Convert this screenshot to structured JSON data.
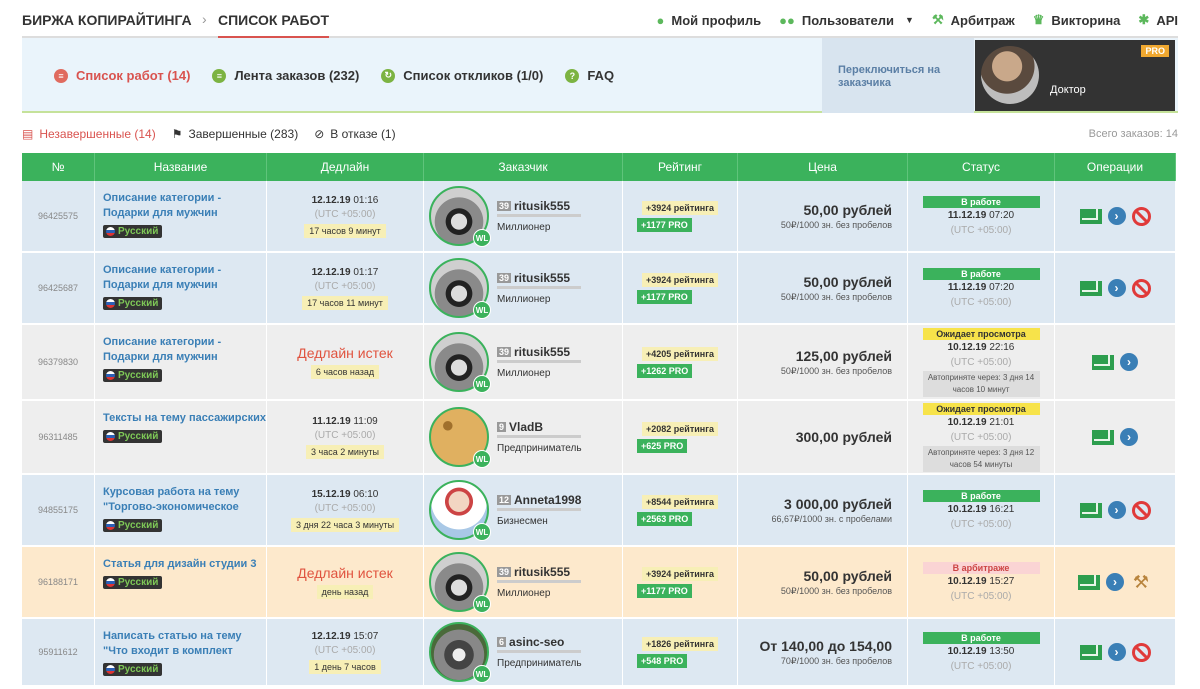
{
  "nav": {
    "brand": "БИРЖА КОПИРАЙТИНГА",
    "sep": "›",
    "current": "СПИСОК РАБОТ",
    "items": [
      {
        "label": "Мой профиль",
        "icon": "user-icon"
      },
      {
        "label": "Пользователи",
        "icon": "users-icon"
      },
      {
        "label": "Арбитраж",
        "icon": "hammer-icon"
      },
      {
        "label": "Викторина",
        "icon": "trophy-icon"
      },
      {
        "label": "API",
        "icon": "gear-icon"
      }
    ]
  },
  "subnav": {
    "tabs": [
      {
        "label": "Список работ (14)",
        "active": true
      },
      {
        "label": "Лента заказов (232)",
        "active": false
      },
      {
        "label": "Список откликов (1/0)",
        "active": false
      },
      {
        "label": "FAQ",
        "active": false
      }
    ],
    "switch_label": "Переключиться на заказчика",
    "profile_name": "Доктор",
    "pro": "PRO"
  },
  "filters": {
    "items": [
      {
        "label": "Незавершенные (14)",
        "active": true
      },
      {
        "label": "Завершенные (283)",
        "active": false
      },
      {
        "label": "В отказе (1)",
        "active": false
      }
    ],
    "total": "Всего заказов: 14"
  },
  "table": {
    "headers": [
      "№",
      "Название",
      "Дедлайн",
      "Заказчик",
      "Рейтинг",
      "Цена",
      "Статус",
      "Операции"
    ],
    "rows": [
      {
        "id": "96425575",
        "title": "Описание категории - Подарки для мужчин",
        "lang": "Русский",
        "dl_date": "12.12.19",
        "dl_time": "01:16",
        "dl_utc": "(UTC +05:00)",
        "dl_left": "17 часов 9 минут",
        "dl_expired": "",
        "cust_level": "39",
        "cust_name": "ritusik555",
        "cust_rank": "Миллионер",
        "ava": "raccoon",
        "r1": "+3924 рейтинга",
        "r2": "+1177 PRO",
        "price": "50,00 рублей",
        "price_sub": "50₽/1000 зн. без пробелов",
        "status": "В работе",
        "status_kind": "green",
        "s_date": "11.12.19",
        "s_time": "07:20",
        "s_utc": "(UTC +05:00)",
        "s_auto": "",
        "ops": [
          "mail",
          "go",
          "ban"
        ]
      },
      {
        "id": "96425687",
        "title": "Описание категории - Подарки для мужчин",
        "lang": "Русский",
        "dl_date": "12.12.19",
        "dl_time": "01:17",
        "dl_utc": "(UTC +05:00)",
        "dl_left": "17 часов 11 минут",
        "dl_expired": "",
        "cust_level": "39",
        "cust_name": "ritusik555",
        "cust_rank": "Миллионер",
        "ava": "raccoon",
        "r1": "+3924 рейтинга",
        "r2": "+1177 PRO",
        "price": "50,00 рублей",
        "price_sub": "50₽/1000 зн. без пробелов",
        "status": "В работе",
        "status_kind": "green",
        "s_date": "11.12.19",
        "s_time": "07:20",
        "s_utc": "(UTC +05:00)",
        "s_auto": "",
        "ops": [
          "mail",
          "go",
          "ban"
        ]
      },
      {
        "id": "96379830",
        "title": "Описание категории - Подарки для мужчин",
        "lang": "Русский",
        "dl_date": "",
        "dl_time": "",
        "dl_utc": "",
        "dl_left": "6 часов назад",
        "dl_expired": "Дедлайн истек",
        "cust_level": "39",
        "cust_name": "ritusik555",
        "cust_rank": "Миллионер",
        "ava": "raccoon",
        "r1": "+4205 рейтинга",
        "r2": "+1262 PRO",
        "price": "125,00 рублей",
        "price_sub": "50₽/1000 зн. без пробелов",
        "status": "Ожидает просмотра",
        "status_kind": "yellow",
        "s_date": "10.12.19",
        "s_time": "22:16",
        "s_utc": "(UTC +05:00)",
        "s_auto": "Автоприняте через: 3 дня 14 часов 10 минут",
        "ops": [
          "mail",
          "go"
        ]
      },
      {
        "id": "96311485",
        "title": "Тексты на тему пассажирских",
        "lang": "Русский",
        "dl_date": "11.12.19",
        "dl_time": "11:09",
        "dl_utc": "(UTC +05:00)",
        "dl_left": "3 часа 2 минуты",
        "dl_expired": "",
        "cust_level": "9",
        "cust_name": "VladB",
        "cust_rank": "Предприниматель",
        "ava": "leopard",
        "r1": "+2082 рейтинга",
        "r2": "+625 PRO",
        "price": "300,00 рублей",
        "price_sub": "",
        "status": "Ожидает просмотра",
        "status_kind": "yellow",
        "s_date": "10.12.19",
        "s_time": "21:01",
        "s_utc": "(UTC +05:00)",
        "s_auto": "Автоприняте через: 3 дня 12 часов 54 минуты",
        "ops": [
          "mail",
          "go"
        ]
      },
      {
        "id": "94855175",
        "title": "Курсовая работа на тему \"Торгово-экономическое",
        "lang": "Русский",
        "dl_date": "15.12.19",
        "dl_time": "06:10",
        "dl_utc": "(UTC +05:00)",
        "dl_left": "3 дня 22 часа 3 минуты",
        "dl_expired": "",
        "cust_level": "12",
        "cust_name": "Anneta1998",
        "cust_rank": "Бизнесмен",
        "ava": "girl",
        "r1": "+8544 рейтинга",
        "r2": "+2563 PRO",
        "price": "3 000,00 рублей",
        "price_sub": "66,67₽/1000 зн. с пробелами",
        "status": "В работе",
        "status_kind": "green",
        "s_date": "10.12.19",
        "s_time": "16:21",
        "s_utc": "(UTC +05:00)",
        "s_auto": "",
        "ops": [
          "mail",
          "go",
          "ban"
        ]
      },
      {
        "id": "96188171",
        "title": "Статья для дизайн студии 3",
        "lang": "Русский",
        "dl_date": "",
        "dl_time": "",
        "dl_utc": "",
        "dl_left": "день назад",
        "dl_expired": "Дедлайн истек",
        "cust_level": "39",
        "cust_name": "ritusik555",
        "cust_rank": "Миллионер",
        "ava": "raccoon",
        "r1": "+3924 рейтинга",
        "r2": "+1177 PRO",
        "price": "50,00 рублей",
        "price_sub": "50₽/1000 зн. без пробелов",
        "status": "В арбитраже",
        "status_kind": "pink",
        "s_date": "10.12.19",
        "s_time": "15:27",
        "s_utc": "(UTC +05:00)",
        "s_auto": "",
        "ops": [
          "mail",
          "go",
          "hammer"
        ]
      },
      {
        "id": "95911612",
        "title": "Написать статью на тему \"Что входит в комплект",
        "lang": "Русский",
        "dl_date": "12.12.19",
        "dl_time": "15:07",
        "dl_utc": "(UTC +05:00)",
        "dl_left": "1 день 7 часов",
        "dl_expired": "",
        "cust_level": "6",
        "cust_name": "asinc-seo",
        "cust_rank": "Предприниматель",
        "ava": "wolf",
        "r1": "+1826 рейтинга",
        "r2": "+548 PRO",
        "price": "От 140,00 до 154,00",
        "price_sub": "70₽/1000 зн. без пробелов",
        "status": "В работе",
        "status_kind": "green",
        "s_date": "10.12.19",
        "s_time": "13:50",
        "s_utc": "(UTC +05:00)",
        "s_auto": "",
        "ops": [
          "mail",
          "go",
          "ban"
        ]
      }
    ]
  }
}
